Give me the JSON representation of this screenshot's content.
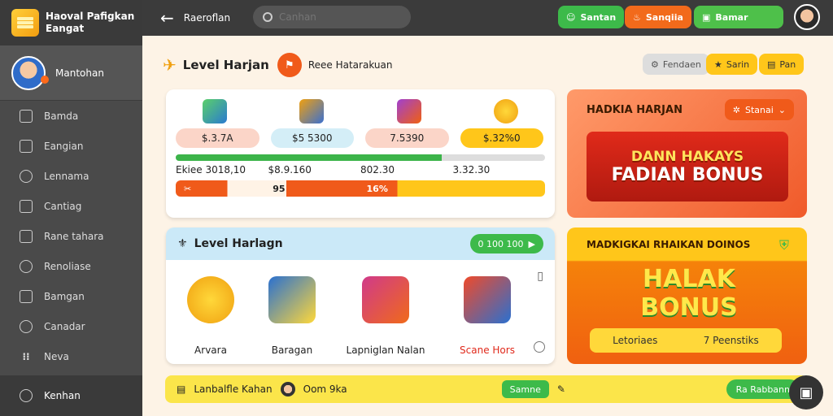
{
  "brand": {
    "line1": "Haoval Pafigkan",
    "line2": "Eangat"
  },
  "profile": {
    "name": "Mantohan"
  },
  "sidebar": {
    "items": [
      {
        "label": "Bamda",
        "icon": "dashboard-icon"
      },
      {
        "label": "Eangian",
        "icon": "calendar-icon"
      },
      {
        "label": "Lennama",
        "icon": "users-icon"
      },
      {
        "label": "Cantiag",
        "icon": "grid-icon"
      },
      {
        "label": "Rane tahara",
        "icon": "chart-icon"
      },
      {
        "label": "Renoliase",
        "icon": "tools-icon"
      },
      {
        "label": "Bamgan",
        "icon": "rocket-icon"
      },
      {
        "label": "Canadar",
        "icon": "search-icon"
      },
      {
        "label": "Neva",
        "icon": "dots-icon"
      }
    ],
    "bottom_label": "Kenhan"
  },
  "topbar": {
    "title": "Raeroflan",
    "search_placeholder": "Canhan",
    "buttons": [
      {
        "label": "Santan",
        "color": "#3dba4a"
      },
      {
        "label": "Sanqiia",
        "color": "#f26a1b"
      },
      {
        "label": "Bamar",
        "color": "#4ec04a"
      }
    ]
  },
  "header": {
    "title": "Level Harjan",
    "sub_title": "Reee Hatarakuan",
    "buttons": [
      {
        "label": "Fendaen"
      },
      {
        "label": "Sarin"
      },
      {
        "label": "Pan"
      }
    ]
  },
  "stats": {
    "pills": [
      "$.3.7A",
      "$5 5300",
      "7.5390",
      "$.32%0"
    ],
    "progress": 0.72,
    "row1": [
      "Ekiee  3018,10",
      "$8.9.160",
      "802.30",
      "3.32.30"
    ],
    "bar_labels": [
      "95",
      "16%"
    ]
  },
  "promo1": {
    "title": "HADKIA HARJAN",
    "badge": "Stanai",
    "banner_line1": "DANN HAKAYS",
    "banner_line2": "FADIAN BONUS"
  },
  "items_card": {
    "title": "Level Harlagn",
    "badge": "0 100 100",
    "items": [
      {
        "label": "Arvara"
      },
      {
        "label": "Baragan"
      },
      {
        "label": "Lapniglan Nalan"
      },
      {
        "label": "Scane Hors"
      }
    ]
  },
  "promo2": {
    "title": "MADKIGKAI RHAIKAN DOINOS",
    "big_line1": "HALAK",
    "big_line2": "BONUS",
    "button_left": "Letoriaes",
    "button_right": "7 Peenstiks"
  },
  "footer": {
    "label": "Lanbalfle Kahan",
    "user": "Oom 9ka",
    "badge": "Samne",
    "right_button": "Ra Rabbann"
  }
}
